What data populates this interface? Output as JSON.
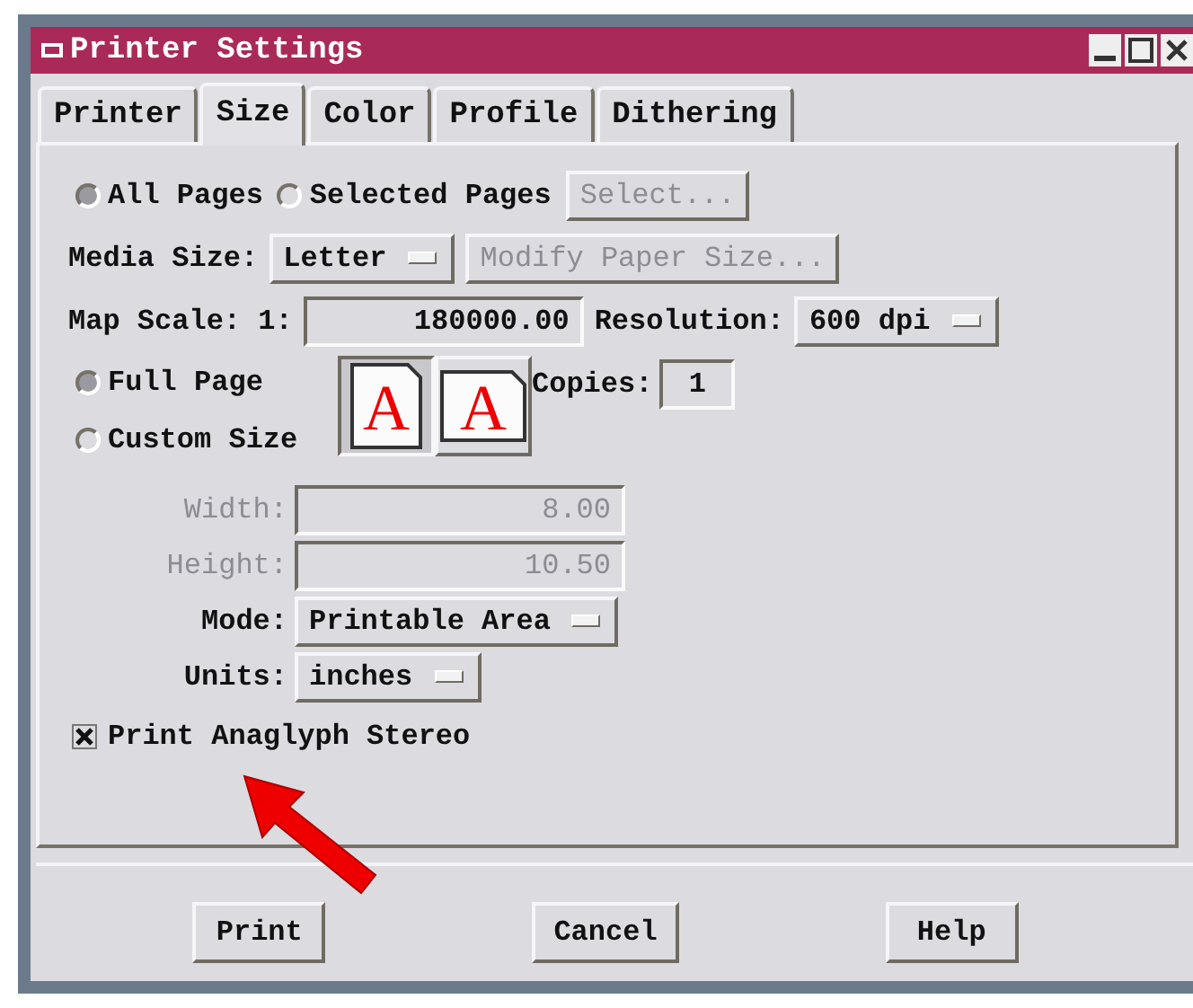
{
  "window": {
    "title": "Printer Settings"
  },
  "tabs": [
    {
      "label": "Printer",
      "selected": false
    },
    {
      "label": "Size",
      "selected": true
    },
    {
      "label": "Color",
      "selected": false
    },
    {
      "label": "Profile",
      "selected": false
    },
    {
      "label": "Dithering",
      "selected": false
    }
  ],
  "pages": {
    "options": [
      {
        "label": "All Pages",
        "selected": true
      },
      {
        "label": "Selected Pages",
        "selected": false
      }
    ],
    "select_button": {
      "label": "Select...",
      "disabled": true
    }
  },
  "media_size": {
    "label": "Media Size:",
    "value": "Letter",
    "modify_button": {
      "label": "Modify Paper Size...",
      "disabled": true
    }
  },
  "map_scale": {
    "label": "Map Scale: 1:",
    "value": "180000.00"
  },
  "resolution": {
    "label": "Resolution:",
    "value": "600 dpi"
  },
  "size_options": [
    {
      "label": "Full Page",
      "selected": true
    },
    {
      "label": "Custom Size",
      "selected": false
    }
  ],
  "orientation": [
    {
      "kind": "portrait",
      "glyph": "A",
      "selected": true
    },
    {
      "kind": "landscape",
      "glyph": "A",
      "selected": false
    }
  ],
  "copies": {
    "label": "Copies:",
    "value": "1"
  },
  "custom_fields": [
    {
      "label": "Width:",
      "value": "8.00",
      "disabled": true
    },
    {
      "label": "Height:",
      "value": "10.50",
      "disabled": true
    }
  ],
  "dropdowns": [
    {
      "label": "Mode:",
      "value": "Printable Area"
    },
    {
      "label": "Units:",
      "value": "inches"
    }
  ],
  "stereo": {
    "label": "Print Anaglyph Stereo",
    "checked": true
  },
  "buttons": [
    "Print",
    "Cancel",
    "Help"
  ]
}
